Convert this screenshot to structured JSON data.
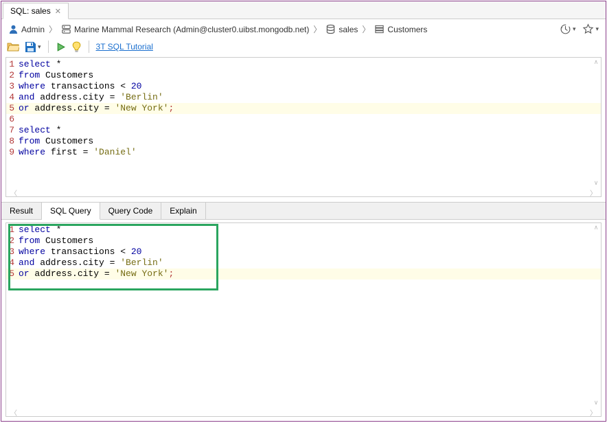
{
  "tab": {
    "label": "SQL: sales"
  },
  "breadcrumb": {
    "user": "Admin",
    "conn": "Marine Mammal Research (Admin@cluster0.uibst.mongodb.net)",
    "db": "sales",
    "coll": "Customers"
  },
  "toolbar": {
    "tutorial_link": "3T SQL Tutorial"
  },
  "editor": {
    "lines": [
      {
        "n": "1",
        "tokens": [
          {
            "t": "select",
            "c": "kw"
          },
          {
            "t": " *"
          }
        ]
      },
      {
        "n": "2",
        "tokens": [
          {
            "t": "from",
            "c": "kw"
          },
          {
            "t": " Customers"
          }
        ]
      },
      {
        "n": "3",
        "tokens": [
          {
            "t": "where",
            "c": "kw"
          },
          {
            "t": " transactions < "
          },
          {
            "t": "20",
            "c": "num"
          }
        ]
      },
      {
        "n": "4",
        "tokens": [
          {
            "t": "and",
            "c": "kw"
          },
          {
            "t": " address.city = "
          },
          {
            "t": "'Berlin'",
            "c": "str"
          }
        ]
      },
      {
        "n": "5",
        "hl": true,
        "tokens": [
          {
            "t": "or",
            "c": "kw"
          },
          {
            "t": " address.city = "
          },
          {
            "t": "'New York'",
            "c": "str"
          },
          {
            "t": ";",
            "c": "semi"
          }
        ]
      },
      {
        "n": "6",
        "tokens": []
      },
      {
        "n": "7",
        "tokens": [
          {
            "t": "select",
            "c": "kw"
          },
          {
            "t": " *"
          }
        ]
      },
      {
        "n": "8",
        "tokens": [
          {
            "t": "from",
            "c": "kw"
          },
          {
            "t": " Customers"
          }
        ]
      },
      {
        "n": "9",
        "tokens": [
          {
            "t": "where",
            "c": "kw"
          },
          {
            "t": " first = "
          },
          {
            "t": "'Daniel'",
            "c": "str"
          }
        ]
      }
    ]
  },
  "result_tabs": {
    "items": [
      "Result",
      "SQL Query",
      "Query Code",
      "Explain"
    ],
    "active": 1
  },
  "result": {
    "lines": [
      {
        "n": "1",
        "tokens": [
          {
            "t": "select",
            "c": "kw"
          },
          {
            "t": " *"
          }
        ]
      },
      {
        "n": "2",
        "tokens": [
          {
            "t": "from",
            "c": "kw"
          },
          {
            "t": " Customers"
          }
        ]
      },
      {
        "n": "3",
        "tokens": [
          {
            "t": "where",
            "c": "kw"
          },
          {
            "t": " transactions < "
          },
          {
            "t": "20",
            "c": "num"
          }
        ]
      },
      {
        "n": "4",
        "tokens": [
          {
            "t": "and",
            "c": "kw"
          },
          {
            "t": " address.city = "
          },
          {
            "t": "'Berlin'",
            "c": "str"
          }
        ]
      },
      {
        "n": "5",
        "hl": true,
        "tokens": [
          {
            "t": "or",
            "c": "kw"
          },
          {
            "t": " address.city = "
          },
          {
            "t": "'New York'",
            "c": "str"
          },
          {
            "t": ";",
            "c": "semi"
          }
        ]
      }
    ]
  }
}
